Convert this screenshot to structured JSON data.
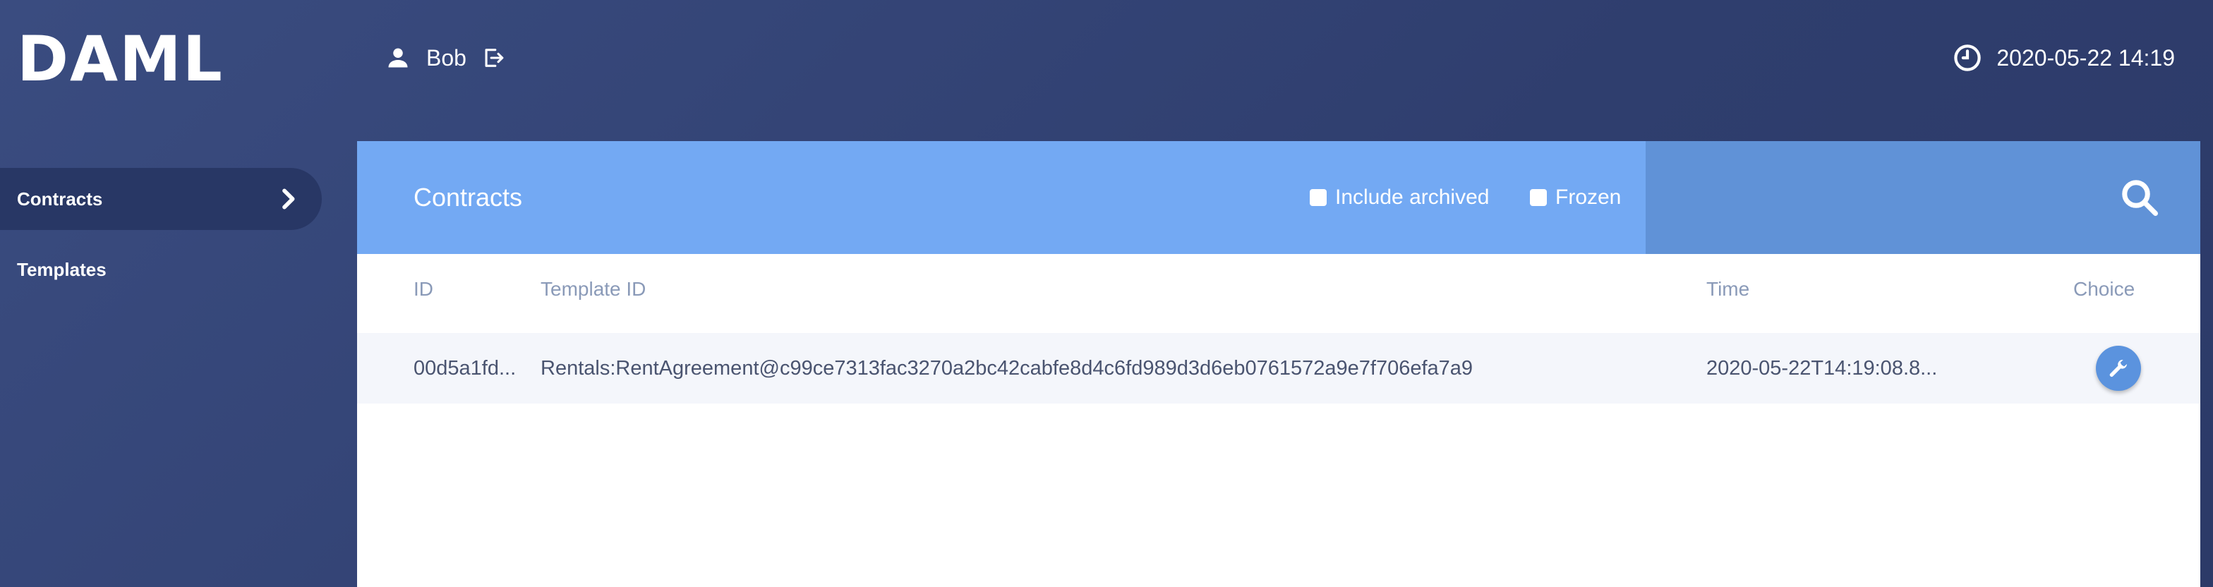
{
  "header": {
    "logo": "DAML",
    "user_name": "Bob",
    "datetime": "2020-05-22 14:19"
  },
  "sidebar": {
    "items": [
      {
        "label": "Contracts",
        "active": true
      },
      {
        "label": "Templates",
        "active": false
      }
    ]
  },
  "main": {
    "title": "Contracts",
    "filters": [
      {
        "label": "Include archived",
        "checked": false
      },
      {
        "label": "Frozen",
        "checked": false
      }
    ],
    "table": {
      "columns": [
        "ID",
        "Template ID",
        "Time",
        "Choice"
      ],
      "rows": [
        {
          "id": "00d5a1fd...",
          "template_id": "Rentals:RentAgreement@c99ce7313fac3270a2bc42cabfe8d4c6fd989d3d6eb0761572a9e7f706efa7a9",
          "time": "2020-05-22T14:19:08.8..."
        }
      ]
    }
  },
  "colors": {
    "background": "#34467a",
    "header_bar": "#73a9f3",
    "search_area": "#6092d7",
    "choice_button": "#5b93de"
  },
  "icons": {
    "user": "user-icon",
    "logout": "logout-icon",
    "clock": "clock-icon",
    "chevron": "chevron-right-icon",
    "search": "search-icon",
    "choice": "wrench-icon"
  }
}
